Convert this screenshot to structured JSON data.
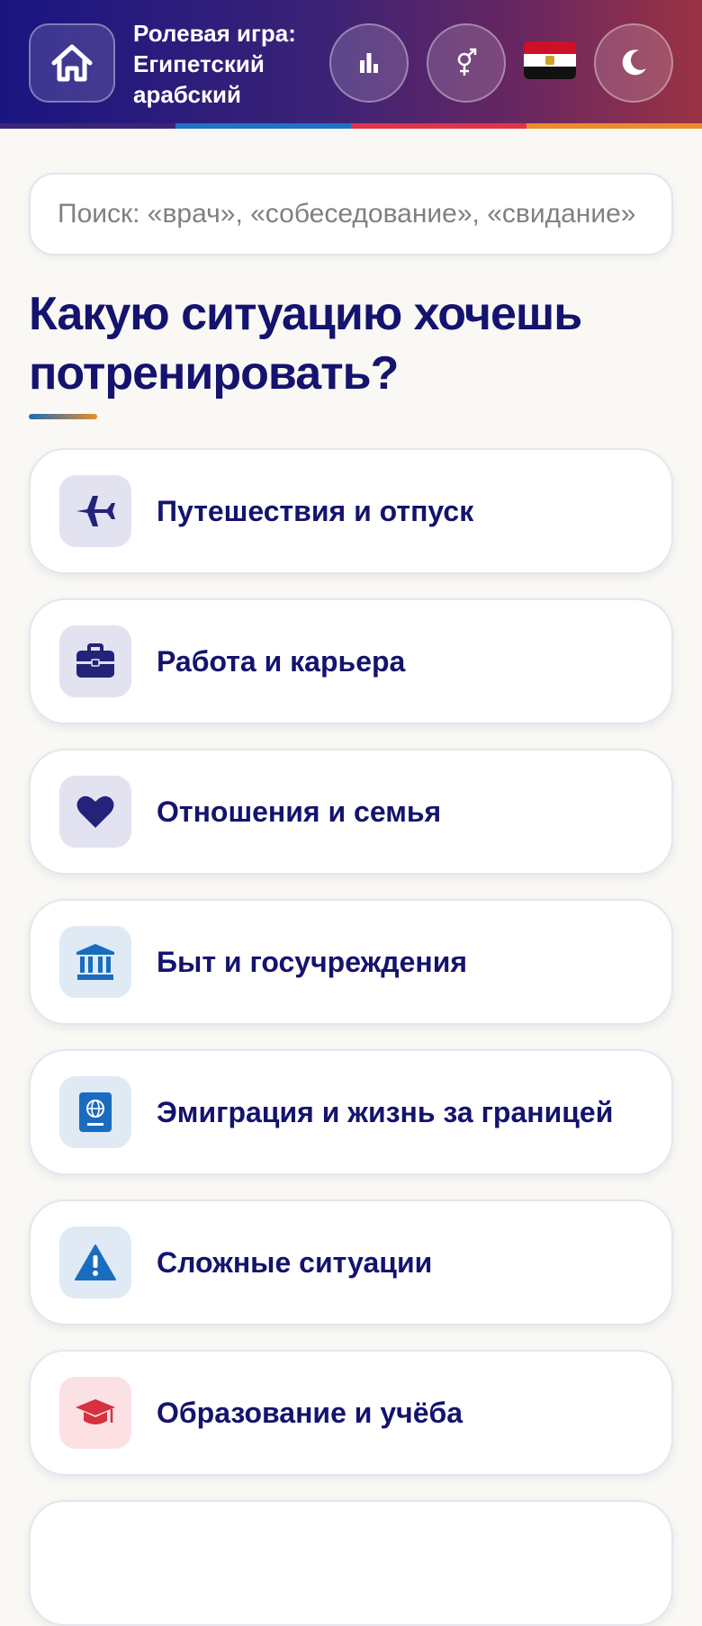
{
  "header": {
    "title": "Ролевая игра: Египетский арабский",
    "stripe_colors": [
      "#3b2578",
      "#1e73c8",
      "#e0344a",
      "#ef8a2c"
    ],
    "buttons": {
      "home": "home-icon",
      "stats": "bar-chart-icon",
      "gender": "gender-icon",
      "language_flag": "egypt-flag-icon",
      "theme": "moon-icon"
    }
  },
  "search": {
    "placeholder": "Поиск: «врач», «собеседование», «свидание»"
  },
  "heading": "Какую ситуацию хочешь потренировать?",
  "categories": [
    {
      "label": "Путешествия и отпуск",
      "icon": "airplane-icon",
      "icon_color": "#23237a",
      "icon_bg": "#e3e2f0"
    },
    {
      "label": "Работа и карьера",
      "icon": "briefcase-icon",
      "icon_color": "#23237a",
      "icon_bg": "#e3e2f0"
    },
    {
      "label": "Отношения и семья",
      "icon": "heart-icon",
      "icon_color": "#23237a",
      "icon_bg": "#e3e2f0"
    },
    {
      "label": "Быт и госучреждения",
      "icon": "bank-icon",
      "icon_color": "#1a6cc0",
      "icon_bg": "#dfeaf5"
    },
    {
      "label": "Эмиграция и жизнь за границей",
      "icon": "passport-icon",
      "icon_color": "#1a6cc0",
      "icon_bg": "#dfeaf5"
    },
    {
      "label": "Сложные ситуации",
      "icon": "warning-icon",
      "icon_color": "#1a6cc0",
      "icon_bg": "#dfeaf5"
    },
    {
      "label": "Образование и учёба",
      "icon": "graduation-cap-icon",
      "icon_color": "#d8303e",
      "icon_bg": "#fbe1e4"
    }
  ]
}
